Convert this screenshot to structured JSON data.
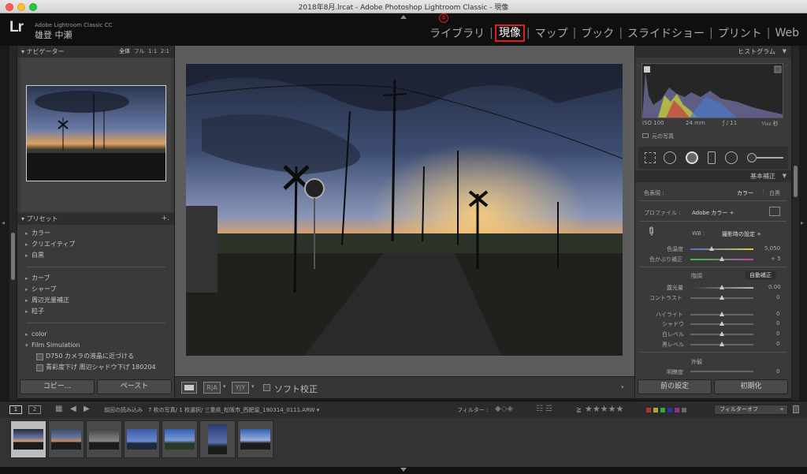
{
  "window": {
    "title": "2018年8月.lrcat - Adobe Photoshop Lightroom Classic - 現像"
  },
  "header": {
    "logo": "Lr",
    "app_name": "Adobe Lightroom Classic CC",
    "user_name": "雄登 中瀬",
    "step_badge": "⑤",
    "modules": [
      "ライブラリ",
      "現像",
      "マップ",
      "ブック",
      "スライドショー",
      "プリント",
      "Web"
    ],
    "active_module": "現像",
    "highlight_color": "#e01e1e"
  },
  "left_panel": {
    "navigator": {
      "title": "ナビゲーター",
      "zoom": [
        "全体",
        "フル",
        "1:1",
        "2:1"
      ]
    },
    "presets": {
      "title": "プリセット",
      "add": "+.",
      "groups1": [
        "カラー",
        "クリエイティブ",
        "白黒"
      ],
      "groups2": [
        "カーブ",
        "シャープ",
        "周辺光量補正",
        "粒子"
      ],
      "groups3": [
        "color",
        "Film Simulation"
      ],
      "items": [
        "D750 カメラの液晶に近づける",
        "青彩度下げ 周辺シャドウ下げ 180204"
      ]
    },
    "copy_label": "コピー...",
    "paste_label": "ペースト"
  },
  "toolbar": {
    "view_rect": "",
    "ra": "R|A",
    "yy": "Y|Y",
    "soft_proof": "ソフト校正"
  },
  "right_panel": {
    "histogram": {
      "title": "ヒストグラム",
      "iso": "ISO 100",
      "focal": "24 mm",
      "aperture": "ƒ / 11",
      "shutter": "¹⁄₁₆₀ 秒",
      "original": "元の写真"
    },
    "basic": {
      "title": "基本補正",
      "treatment_label": "色表現 :",
      "color": "カラー",
      "bw": "白黒",
      "profile_label": "プロファイル :",
      "profile_value": "Adobe カラー ÷",
      "wb_label": "WB :",
      "wb_value": "撮影時の設定 ÷",
      "temp_label": "色温度",
      "temp_value": "5,050",
      "tint_label": "色かぶり補正",
      "tint_value": "+ 5",
      "tone_label": "階調",
      "auto": "自動補正",
      "exposure_label": "露光量",
      "exposure_value": "0.00",
      "contrast_label": "コントラスト",
      "contrast_value": "0",
      "highlights_label": "ハイライト",
      "highlights_value": "0",
      "shadows_label": "シャドウ",
      "shadows_value": "0",
      "whites_label": "白レベル",
      "whites_value": "0",
      "blacks_label": "黒レベル",
      "blacks_value": "0",
      "presence_label": "外観",
      "clarity_label": "明瞭度",
      "clarity_value": "0"
    },
    "prev_label": "前の設定",
    "reset_label": "初期化"
  },
  "filmstrip": {
    "page1": "1",
    "page2": "2",
    "info": "前回の読み込み　7 枚の写真/ 1 枚選択/ 三重県_松阪市_西肥留_190314_0111.ARW ▾",
    "filter_label": "フィルター :",
    "stars_prefix": "≧",
    "stars": "★★★★★",
    "filter_off": "フィルターオフ",
    "thumb_count": 7
  }
}
